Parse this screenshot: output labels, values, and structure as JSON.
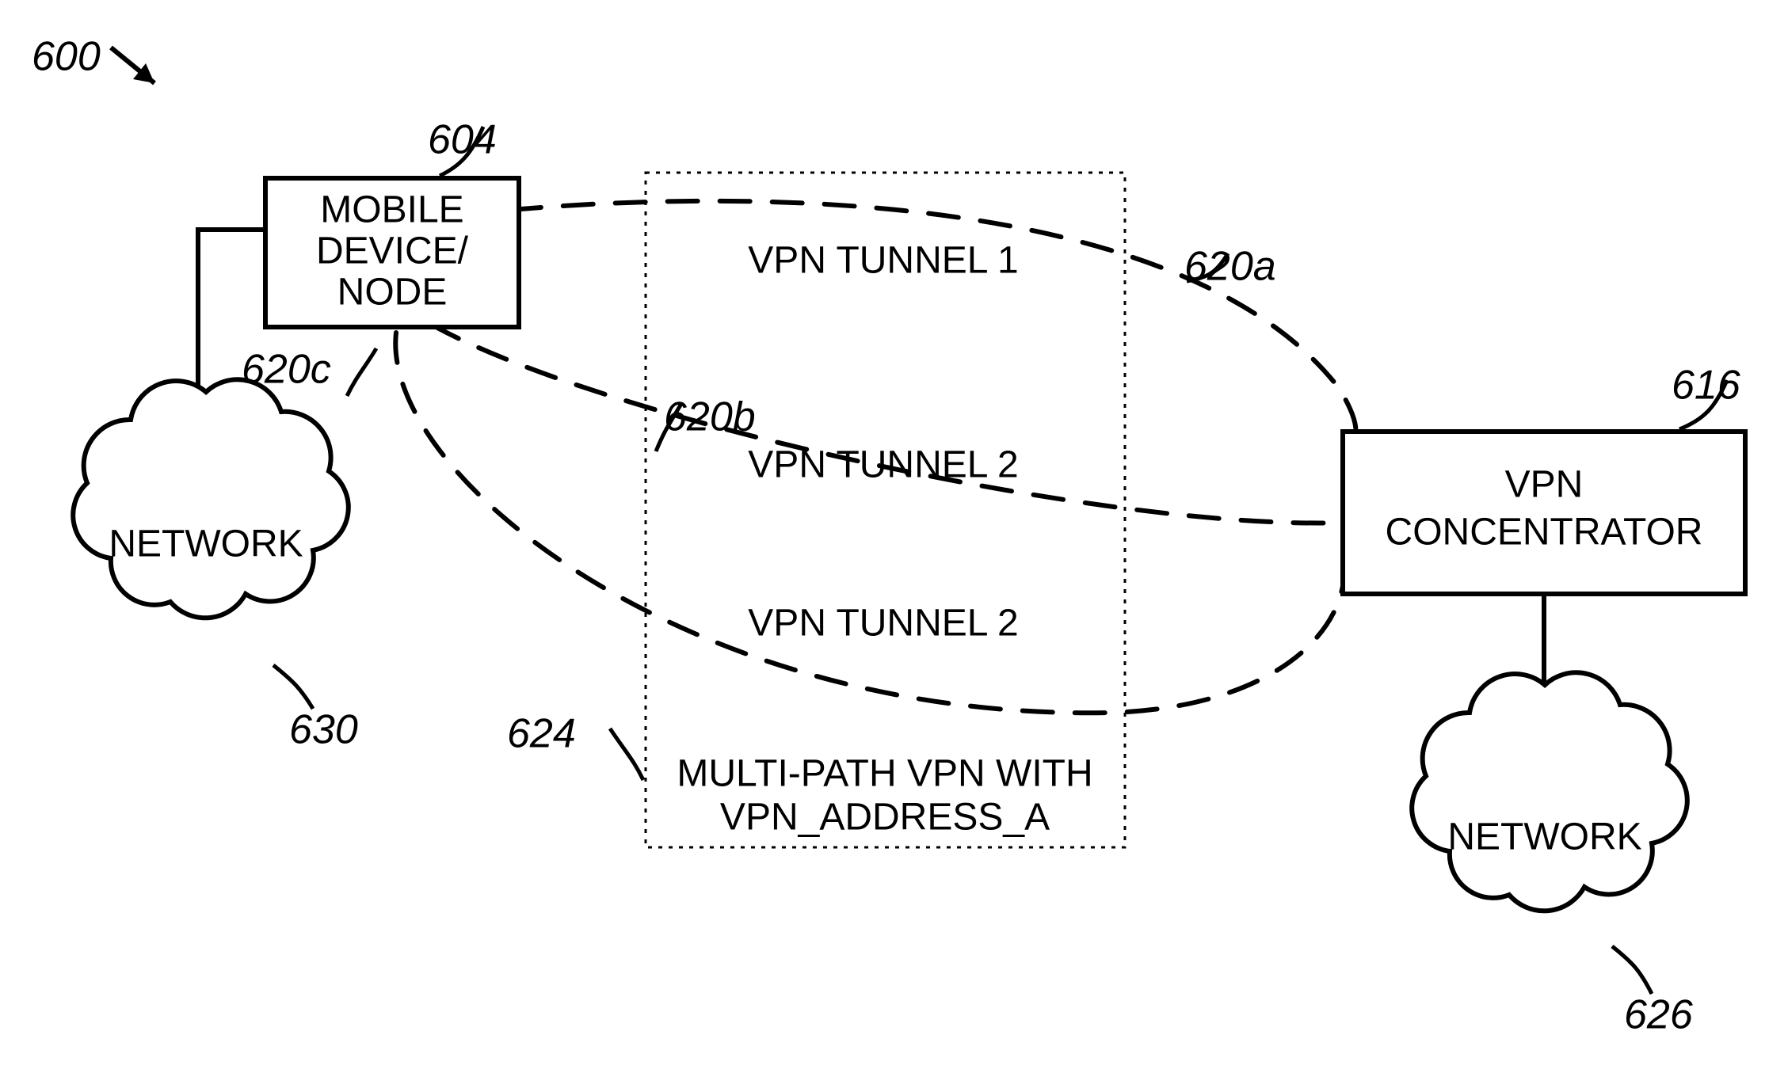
{
  "figure_ref": "600",
  "mobile": {
    "ref": "604",
    "line1": "MOBILE",
    "line2": "DEVICE/",
    "line3": "NODE"
  },
  "concentrator": {
    "ref": "616",
    "line1": "VPN",
    "line2": "CONCENTRATOR"
  },
  "network_left": {
    "ref": "630",
    "label": "NETWORK"
  },
  "network_right": {
    "ref": "626",
    "label": "NETWORK"
  },
  "multipath": {
    "ref": "624",
    "line1": "MULTI-PATH VPN WITH",
    "line2": "VPN_ADDRESS_A"
  },
  "tunnels": {
    "a": {
      "ref": "620a",
      "label": "VPN TUNNEL 1"
    },
    "b": {
      "ref": "620b",
      "label": "VPN TUNNEL 2"
    },
    "c": {
      "ref": "620c",
      "label": "VPN TUNNEL 2"
    }
  }
}
